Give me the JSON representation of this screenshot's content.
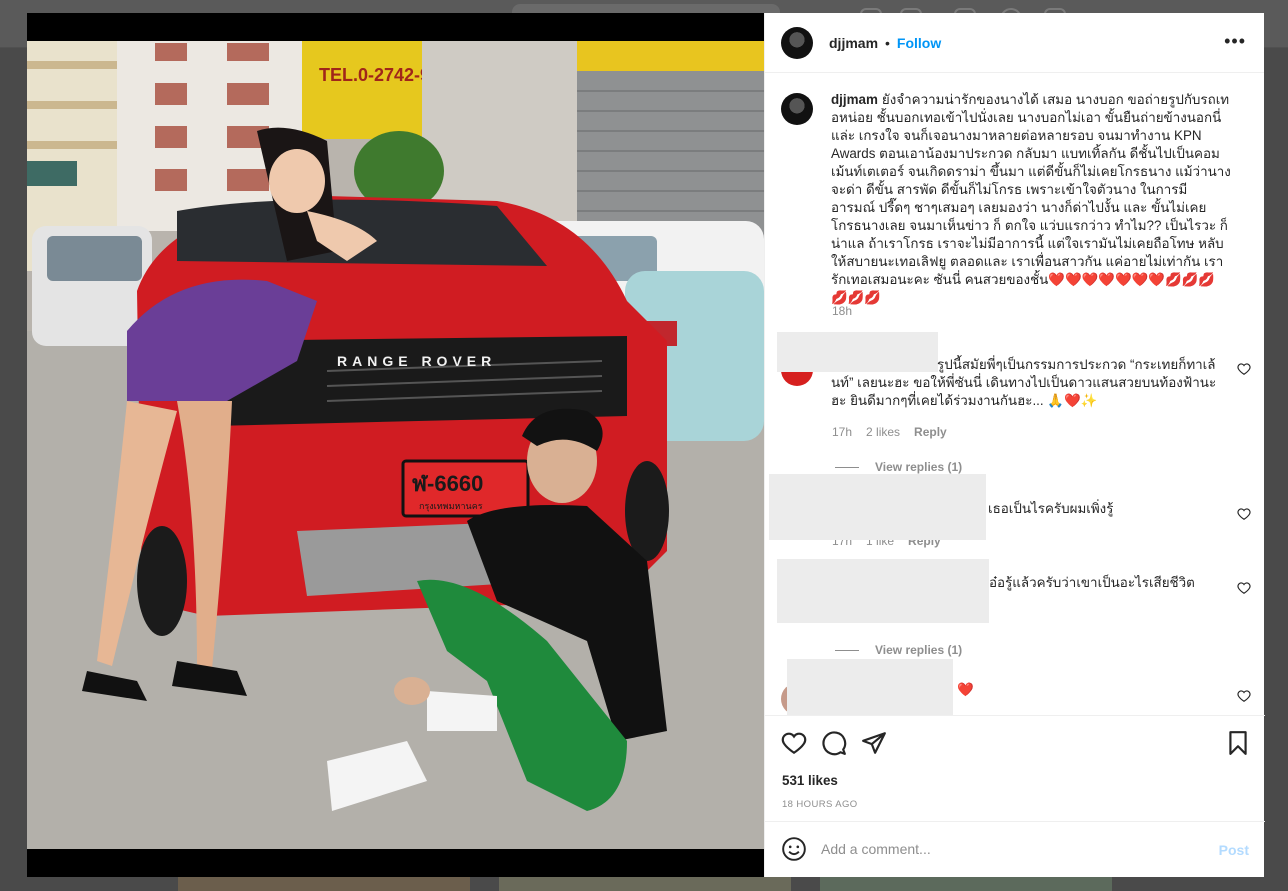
{
  "post": {
    "username": "djjmam",
    "follow_label": "Follow",
    "more_label": "•••",
    "caption_text": "ยังจำความน่ารักของนางได้ เสมอ นางบอก ขอถ่ายรูปกับรถเทอหน่อย ชั้นบอกเทอเข้าไปนั่งเลย นางบอกไม่เอา ขั้นยืนถ่ายข้างนอกนี่แล่ะ เกรงใจ จนก็เจอนางมาหลายต่อหลายรอบ จนมาทำงาน KPN Awards ตอนเอาน้องมาประกวด กลับมา แบทเทิ้ลกัน ดีชั้นไปเป็นคอมเม้นท์เตเตอร์ จนเกิดดราม่า ขึ้นมา แต่ดีขั้นก็ไม่เคยโกรธนาง แม้ว่านางจะด่า ดีขั้น สารพัด ดีขั้นก็ไม่โกรธ เพราะเข้าใจตัวนาง ในการมีอารมณ์ ปรี๊ดๆ ชาๆเสมอๆ เลยมองว่า นางก็ด่าไปงั้น และ ขั้นไม่เคยโกรธนางเลย จนมาเห็นข่าว ก็ ตกใจ แว่บแรกว่าว ทำไม?? เป็นไรวะ ก็น่าแล ถ้าเราโกรธ เราจะไม่มีอาการนี้ แต่ใจเรามันไม่เคยถือโทษ หลับให้สบายนะเทอเลิฟยู ตลอดและ เราเพื่อนสาวกัน แค่อายไม่เท่ากัน เรารักเทอเสมอนะคะ ซันนี่ คนสวยของชั้น",
    "caption_emoji": "❤️❤️❤️❤️❤️❤️❤️💋💋💋💋💋💋",
    "caption_time": "18h",
    "likes": "531 likes",
    "posted": "18 HOURS AGO"
  },
  "comments": [
    {
      "text": "รูปนี้สมัยพี่ๆเป็นกรรมการประกวด “กระเทยก็ทาเล้นท์” เลยนะฮะ ขอให้พี่ซันนี่ เดินทางไปเป็นดาวแสนสวยบนท้องฟ้านะฮะ ยินดีมากๆที่เคยได้ร่วมงานกันฮะ... 🙏❤️✨",
      "time": "17h",
      "likes": "2 likes",
      "reply": "Reply",
      "view_replies": "View replies (1)"
    },
    {
      "text": "เธอเป็นไรครับผมเพิ่งรู้",
      "time": "17h",
      "likes": "1 like",
      "reply": "Reply"
    },
    {
      "text": "อ๋อรู้แล้วครับว่าเขาเป็นอะไรเสียชีวิต",
      "view_replies": "View replies (1)"
    },
    {
      "text": "❤️"
    }
  ],
  "photo": {
    "plate_text": "ฬ-6660",
    "plate_sub": "กรุงเทพมหานคร",
    "hood_text": "RANGE ROVER",
    "sign_text": "TEL.0-2742-9"
  },
  "composer": {
    "placeholder": "Add a comment...",
    "post_label": "Post"
  },
  "colors": {
    "link": "#0095f6",
    "muted": "#8e8e8e",
    "like_red": "#ed4956"
  }
}
